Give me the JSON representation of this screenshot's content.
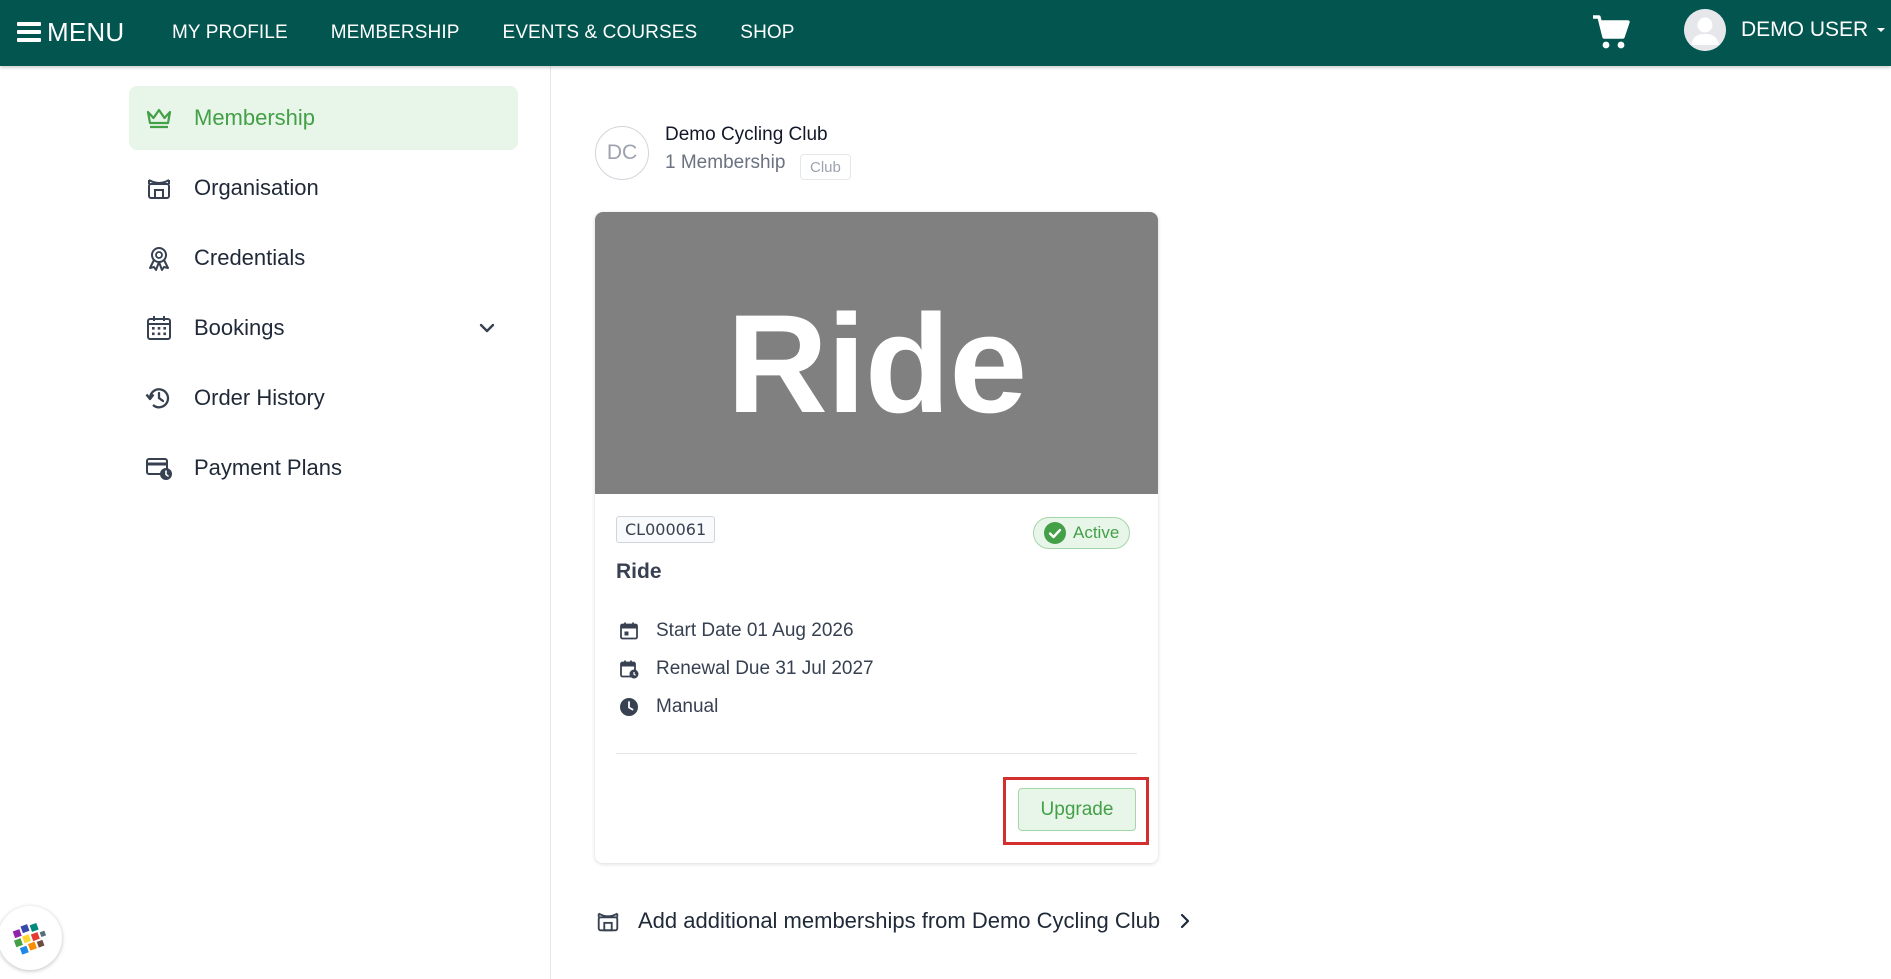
{
  "topbar": {
    "menu_label": "MENU",
    "links": [
      "MY PROFILE",
      "MEMBERSHIP",
      "EVENTS & COURSES",
      "SHOP"
    ],
    "user_name": "DEMO USER"
  },
  "sidebar": {
    "items": [
      {
        "label": "Membership",
        "icon": "crown-icon",
        "active": true
      },
      {
        "label": "Organisation",
        "icon": "organisation-icon"
      },
      {
        "label": "Credentials",
        "icon": "award-icon"
      },
      {
        "label": "Bookings",
        "icon": "calendar-icon",
        "expandable": true
      },
      {
        "label": "Order History",
        "icon": "history-icon"
      },
      {
        "label": "Payment Plans",
        "icon": "payment-plan-icon"
      }
    ]
  },
  "club": {
    "initials": "DC",
    "name": "Demo Cycling Club",
    "membership_count": "1 Membership",
    "tag": "Club"
  },
  "membership_card": {
    "banner_text": "Ride",
    "code": "CL000061",
    "status": "Active",
    "title": "Ride",
    "start_date": "Start Date 01 Aug 2026",
    "renewal_due": "Renewal Due 31 Jul 2027",
    "renewal_type": "Manual",
    "upgrade_label": "Upgrade"
  },
  "add_more_label": "Add additional memberships from Demo Cycling Club",
  "colors": {
    "topbar": "#03554f",
    "accent_green": "#43a047",
    "active_bg": "#e8f5e9",
    "highlight_red": "#d32f2f",
    "banner_grey": "#808080"
  }
}
